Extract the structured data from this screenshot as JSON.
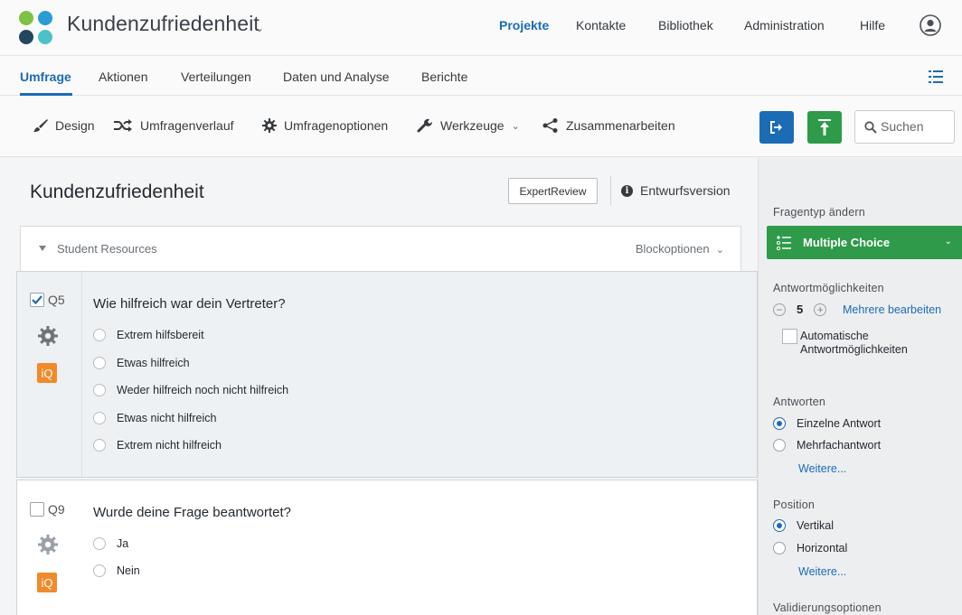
{
  "header": {
    "project_title": "Kundenzufriedenheit",
    "nav": [
      "Projekte",
      "Kontakte",
      "Bibliothek",
      "Administration",
      "Hilfe"
    ],
    "active_nav": "Projekte",
    "logo_colors": [
      "#7dc242",
      "#2b9bd6",
      "#24465e",
      "#4dc1c9"
    ]
  },
  "tabs": {
    "items": [
      "Umfrage",
      "Aktionen",
      "Verteilungen",
      "Daten und Analyse",
      "Berichte"
    ],
    "active": "Umfrage"
  },
  "toolbar": {
    "design": "Design",
    "flow": "Umfragenverlauf",
    "options": "Umfragenoptionen",
    "tools": "Werkzeuge",
    "collab": "Zusammenarbeiten",
    "search_placeholder": "Suchen",
    "preview_icon": "preview-icon",
    "publish_icon": "publish-icon"
  },
  "editor": {
    "survey_title": "Kundenzufriedenheit",
    "expert_review": "ExpertReview",
    "draft_label": "Entwurfsversion",
    "block": {
      "name": "Student Resources",
      "options_label": "Blockoptionen"
    },
    "questions": [
      {
        "number": "Q5",
        "checked": true,
        "text": "Wie hilfreich war dein Vertreter?",
        "choices": [
          "Extrem hilfsbereit",
          "Etwas hilfreich",
          "Weder hilfreich noch nicht hilfreich",
          "Etwas nicht hilfreich",
          "Extrem nicht hilfreich"
        ]
      },
      {
        "number": "Q9",
        "checked": false,
        "text": "Wurde deine Frage beantwortet?",
        "choices": [
          "Ja",
          "Nein"
        ]
      }
    ]
  },
  "panel": {
    "change_type_label": "Fragentyp ändern",
    "question_type": "Multiple Choice",
    "choices_label": "Antwortmöglichkeiten",
    "choice_count": "5",
    "edit_multiple": "Mehrere bearbeiten",
    "auto_choices_line1": "Automatische",
    "auto_choices_line2": "Antwortmöglichkeiten",
    "answers_label": "Antworten",
    "answer_single": "Einzelne Antwort",
    "answer_multi": "Mehrfachantwort",
    "more_1": "Weitere...",
    "position_label": "Position",
    "pos_vertical": "Vertikal",
    "pos_horizontal": "Horizontal",
    "more_2": "Weitere...",
    "validation_label": "Validierungsoptionen"
  },
  "colors": {
    "accent_blue": "#1c6bb5",
    "accent_green": "#2f9a4a",
    "iq_orange": "#f28a2b"
  }
}
